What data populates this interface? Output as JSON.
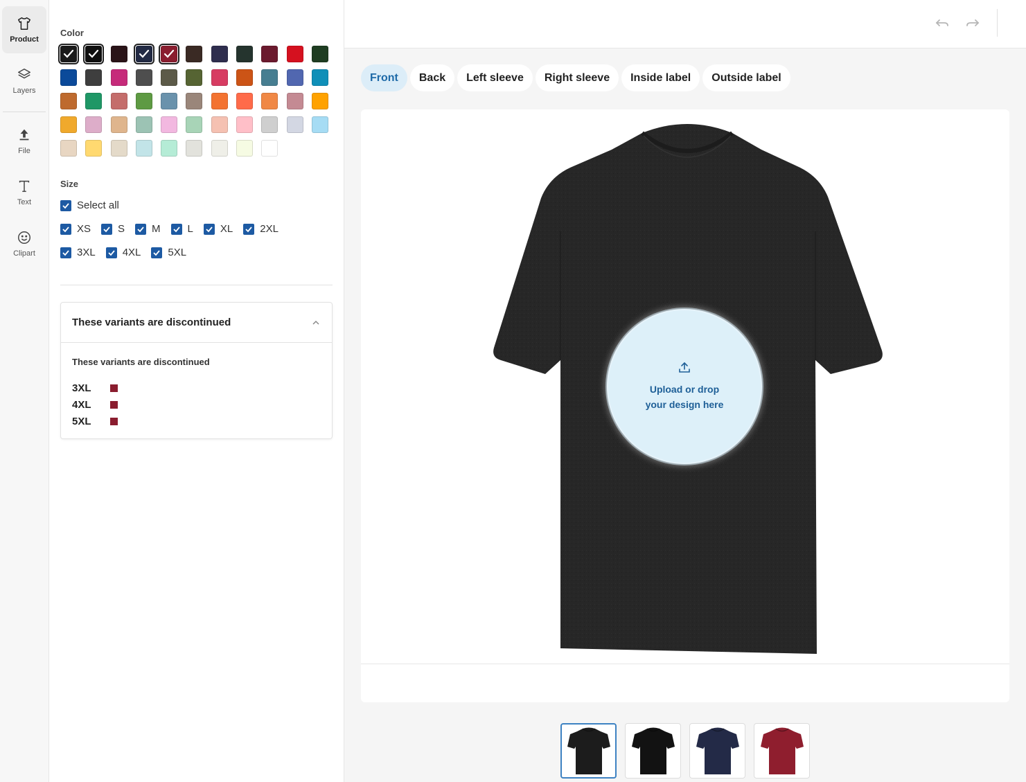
{
  "rail": {
    "items": [
      {
        "label": "Product",
        "icon": "tshirt-icon"
      },
      {
        "label": "Layers",
        "icon": "layers-icon"
      },
      {
        "label": "File",
        "icon": "upload-icon"
      },
      {
        "label": "Text",
        "icon": "text-icon"
      },
      {
        "label": "Clipart",
        "icon": "smiley-icon"
      }
    ]
  },
  "panel": {
    "color_label": "Color",
    "colors": [
      {
        "hex": "#1a1a1a",
        "selected": true
      },
      {
        "hex": "#0f0f0f",
        "selected": true
      },
      {
        "hex": "#2a1418",
        "selected": false
      },
      {
        "hex": "#222a44",
        "selected": true
      },
      {
        "hex": "#8a1d2f",
        "selected": true
      },
      {
        "hex": "#3a2a24",
        "selected": false
      },
      {
        "hex": "#2f2e4e",
        "selected": false
      },
      {
        "hex": "#25342e",
        "selected": false
      },
      {
        "hex": "#6b1a2e",
        "selected": false
      },
      {
        "hex": "#d5111f",
        "selected": false
      },
      {
        "hex": "#1f3d22",
        "selected": false
      },
      {
        "hex": "#0b4a9a",
        "selected": false
      },
      {
        "hex": "#3e3e3e",
        "selected": false
      },
      {
        "hex": "#c62a7a",
        "selected": false
      },
      {
        "hex": "#4e4e4e",
        "selected": false
      },
      {
        "hex": "#5c5a48",
        "selected": false
      },
      {
        "hex": "#566433",
        "selected": false
      },
      {
        "hex": "#d73c62",
        "selected": false
      },
      {
        "hex": "#cc5416",
        "selected": false
      },
      {
        "hex": "#477e91",
        "selected": false
      },
      {
        "hex": "#5167b0",
        "selected": false
      },
      {
        "hex": "#0f8fb8",
        "selected": false
      },
      {
        "hex": "#be6a2e",
        "selected": false
      },
      {
        "hex": "#1f9766",
        "selected": false
      },
      {
        "hex": "#c46d6b",
        "selected": false
      },
      {
        "hex": "#5e9a43",
        "selected": false
      },
      {
        "hex": "#6a92ac",
        "selected": false
      },
      {
        "hex": "#9a867a",
        "selected": false
      },
      {
        "hex": "#f37331",
        "selected": false
      },
      {
        "hex": "#ff6b4a",
        "selected": false
      },
      {
        "hex": "#f08845",
        "selected": false
      },
      {
        "hex": "#c48a93",
        "selected": false
      },
      {
        "hex": "#ffa200",
        "selected": false
      },
      {
        "hex": "#f0a92c",
        "selected": false
      },
      {
        "hex": "#ddadc9",
        "selected": false
      },
      {
        "hex": "#dfb58d",
        "selected": false
      },
      {
        "hex": "#9cc3b4",
        "selected": false
      },
      {
        "hex": "#f2b8e0",
        "selected": false
      },
      {
        "hex": "#a8d4b7",
        "selected": false
      },
      {
        "hex": "#f5c1b2",
        "selected": false
      },
      {
        "hex": "#ffbfc8",
        "selected": false
      },
      {
        "hex": "#cfcfcf",
        "selected": false
      },
      {
        "hex": "#d3d7e3",
        "selected": false
      },
      {
        "hex": "#a6dcf4",
        "selected": false
      },
      {
        "hex": "#e8d6c2",
        "selected": false
      },
      {
        "hex": "#ffd970",
        "selected": false
      },
      {
        "hex": "#e4dac9",
        "selected": false
      },
      {
        "hex": "#c2e4e8",
        "selected": false
      },
      {
        "hex": "#b5ecd6",
        "selected": false
      },
      {
        "hex": "#e2e2dc",
        "selected": false
      },
      {
        "hex": "#efefe8",
        "selected": false
      },
      {
        "hex": "#f6fbe3",
        "selected": false
      },
      {
        "hex": "#ffffff",
        "selected": false
      }
    ],
    "size_label": "Size",
    "select_all": "Select all",
    "sizes_row1": [
      "XS",
      "S",
      "M",
      "L",
      "XL",
      "2XL"
    ],
    "sizes_row2": [
      "3XL",
      "4XL",
      "5XL"
    ],
    "discontinued": {
      "title": "These variants are discontinued",
      "subtitle": "These variants are discontinued",
      "items": [
        {
          "size": "3XL",
          "color": "#8a1d2f"
        },
        {
          "size": "4XL",
          "color": "#8a1d2f"
        },
        {
          "size": "5XL",
          "color": "#8a1d2f"
        }
      ]
    }
  },
  "main": {
    "tabs": [
      "Front",
      "Back",
      "Left sleeve",
      "Right sleeve",
      "Inside label",
      "Outside label"
    ],
    "active_tab": "Front",
    "drop_zone": {
      "line1": "Upload or drop",
      "line2": "your design here"
    },
    "thumbnails": [
      {
        "color": "#1c1c1c",
        "active": true
      },
      {
        "color": "#121212",
        "active": false
      },
      {
        "color": "#232a47",
        "active": false
      },
      {
        "color": "#8f1e2e",
        "active": false
      }
    ]
  },
  "colors": {
    "accent": "#1e6aa8",
    "checkbox": "#1d5aa3",
    "tab_active_bg": "#dcedf8",
    "shirt": "#272727"
  }
}
